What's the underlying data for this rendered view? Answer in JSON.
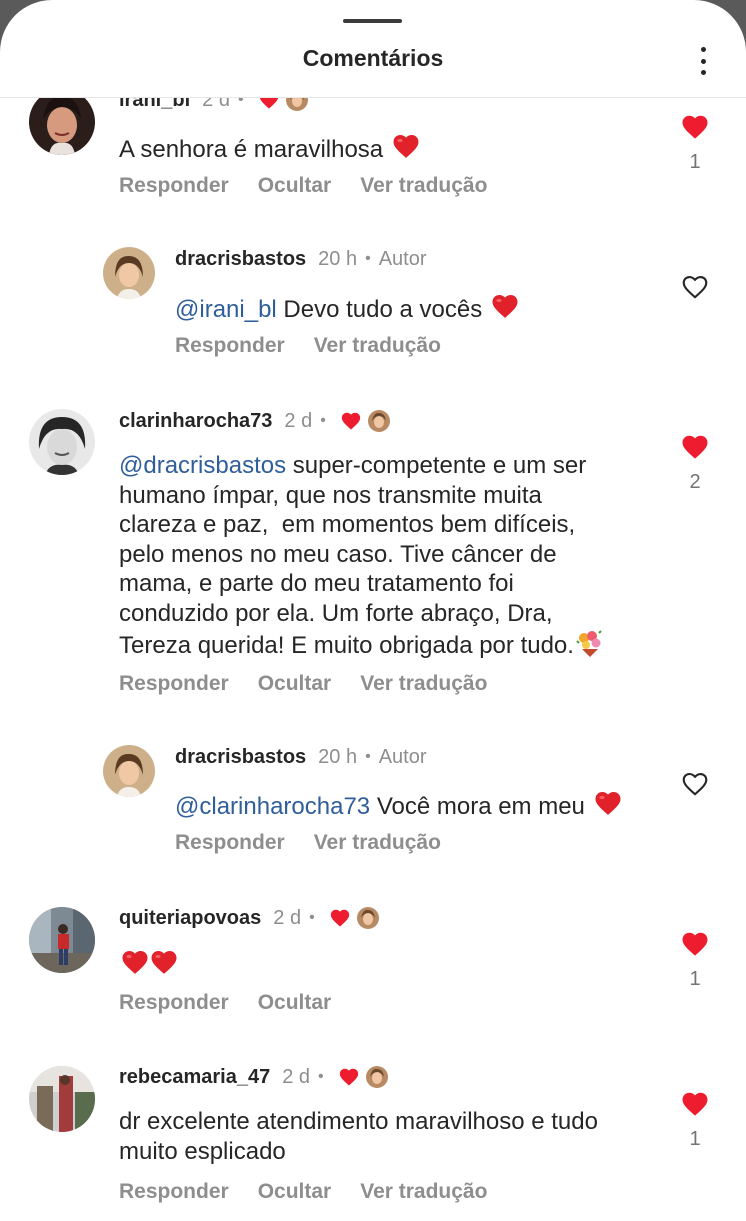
{
  "header": {
    "title": "Comentários"
  },
  "colors": {
    "like_red": "#ed1d2f",
    "mention_blue": "#2f5e9b",
    "muted": "#8e8e8e"
  },
  "icons": {
    "kebab": "more-options-icon",
    "heart_filled": "heart-filled-icon",
    "heart_outline": "heart-outline-icon",
    "bouquet": "bouquet-emoji"
  },
  "comments": [
    {
      "username": "irani_bl",
      "time": "2 d",
      "text_parts": [
        "A senhora é maravilhosa"
      ],
      "actions": [
        "Responder",
        "Ocultar",
        "Ver tradução"
      ],
      "likes": "1",
      "liked": true
    },
    {
      "username": "dracrisbastos",
      "time": "20 h",
      "author_badge": "Autor",
      "mention": "@irani_bl",
      "text_parts": [
        "Devo tudo a vocês"
      ],
      "actions": [
        "Responder",
        "Ver tradução"
      ],
      "liked": false
    },
    {
      "username": "clarinharocha73",
      "time": "2 d",
      "mention": "@dracrisbastos",
      "text_parts": [
        " super-competente e um ser",
        "humano ímpar, que nos transmite muita",
        "clareza e paz,  em momentos bem difíceis,",
        "pelo menos no meu caso. Tive câncer de",
        "mama, e parte do meu tratamento foi",
        "conduzido por ela. Um forte abraço, Dra,",
        "Tereza querida! E muito obrigada por tudo."
      ],
      "actions": [
        "Responder",
        "Ocultar",
        "Ver tradução"
      ],
      "likes": "2",
      "liked": true
    },
    {
      "username": "dracrisbastos",
      "time": "20 h",
      "author_badge": "Autor",
      "mention": "@clarinharocha73",
      "text_parts": [
        "Você mora em meu"
      ],
      "actions": [
        "Responder",
        "Ver tradução"
      ],
      "liked": false
    },
    {
      "username": "quiteriapovoas",
      "time": "2 d",
      "actions": [
        "Responder",
        "Ocultar"
      ],
      "likes": "1",
      "liked": true
    },
    {
      "username": "rebecamaria_47",
      "time": "2 d",
      "text_parts": [
        "dr excelente atendimento maravilhoso e tudo",
        "muito esplicado"
      ],
      "actions": [
        "Responder",
        "Ocultar",
        "Ver tradução"
      ],
      "likes": "1",
      "liked": true
    }
  ],
  "meta": {
    "dot": "•"
  }
}
